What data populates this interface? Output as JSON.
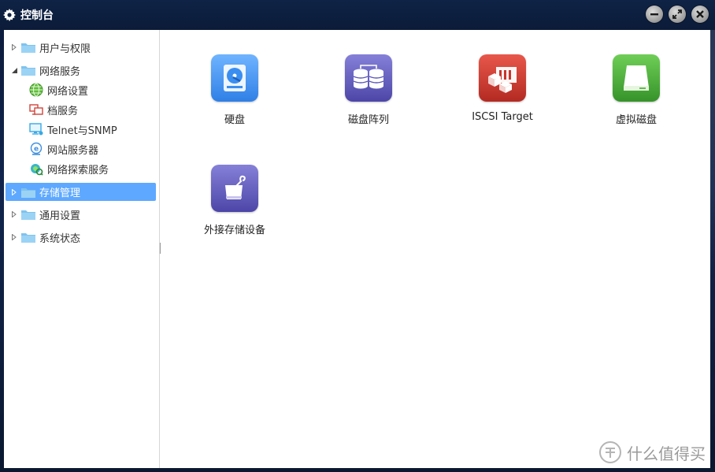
{
  "window": {
    "title": "控制台",
    "controls": [
      "minimize-icon",
      "maximize-icon",
      "close-icon"
    ]
  },
  "sidebar": {
    "groups": [
      {
        "label": "用户与权限",
        "expanded": false,
        "selected": false
      },
      {
        "label": "网络服务",
        "expanded": true,
        "selected": false,
        "children": [
          {
            "label": "网络设置",
            "icon": "globe-icon"
          },
          {
            "label": "档服务",
            "icon": "file-share-icon"
          },
          {
            "label": "Telnet与SNMP",
            "icon": "monitor-icon"
          },
          {
            "label": "网站服务器",
            "icon": "web-server-icon"
          },
          {
            "label": "网络探索服务",
            "icon": "network-discovery-icon"
          }
        ]
      },
      {
        "label": "存储管理",
        "expanded": false,
        "selected": true
      },
      {
        "label": "通用设置",
        "expanded": false,
        "selected": false
      },
      {
        "label": "系统状态",
        "expanded": false,
        "selected": false
      }
    ]
  },
  "main": {
    "tiles": [
      {
        "label": "硬盘",
        "icon": "hard-disk-icon",
        "color": "#3d8ff0"
      },
      {
        "label": "磁盘阵列",
        "icon": "disk-array-icon",
        "color": "#5c55b8"
      },
      {
        "label": "ISCSI Target",
        "icon": "iscsi-target-icon",
        "color": "#c8352b"
      },
      {
        "label": "虚拟磁盘",
        "icon": "virtual-disk-icon",
        "color": "#4aa83a"
      },
      {
        "label": "外接存储设备",
        "icon": "external-storage-icon",
        "color": "#5c55b8"
      }
    ]
  },
  "watermark": {
    "text": "什么值得买"
  },
  "colors": {
    "selection": "#5ea9ff",
    "titlebar": "#0f2346"
  }
}
